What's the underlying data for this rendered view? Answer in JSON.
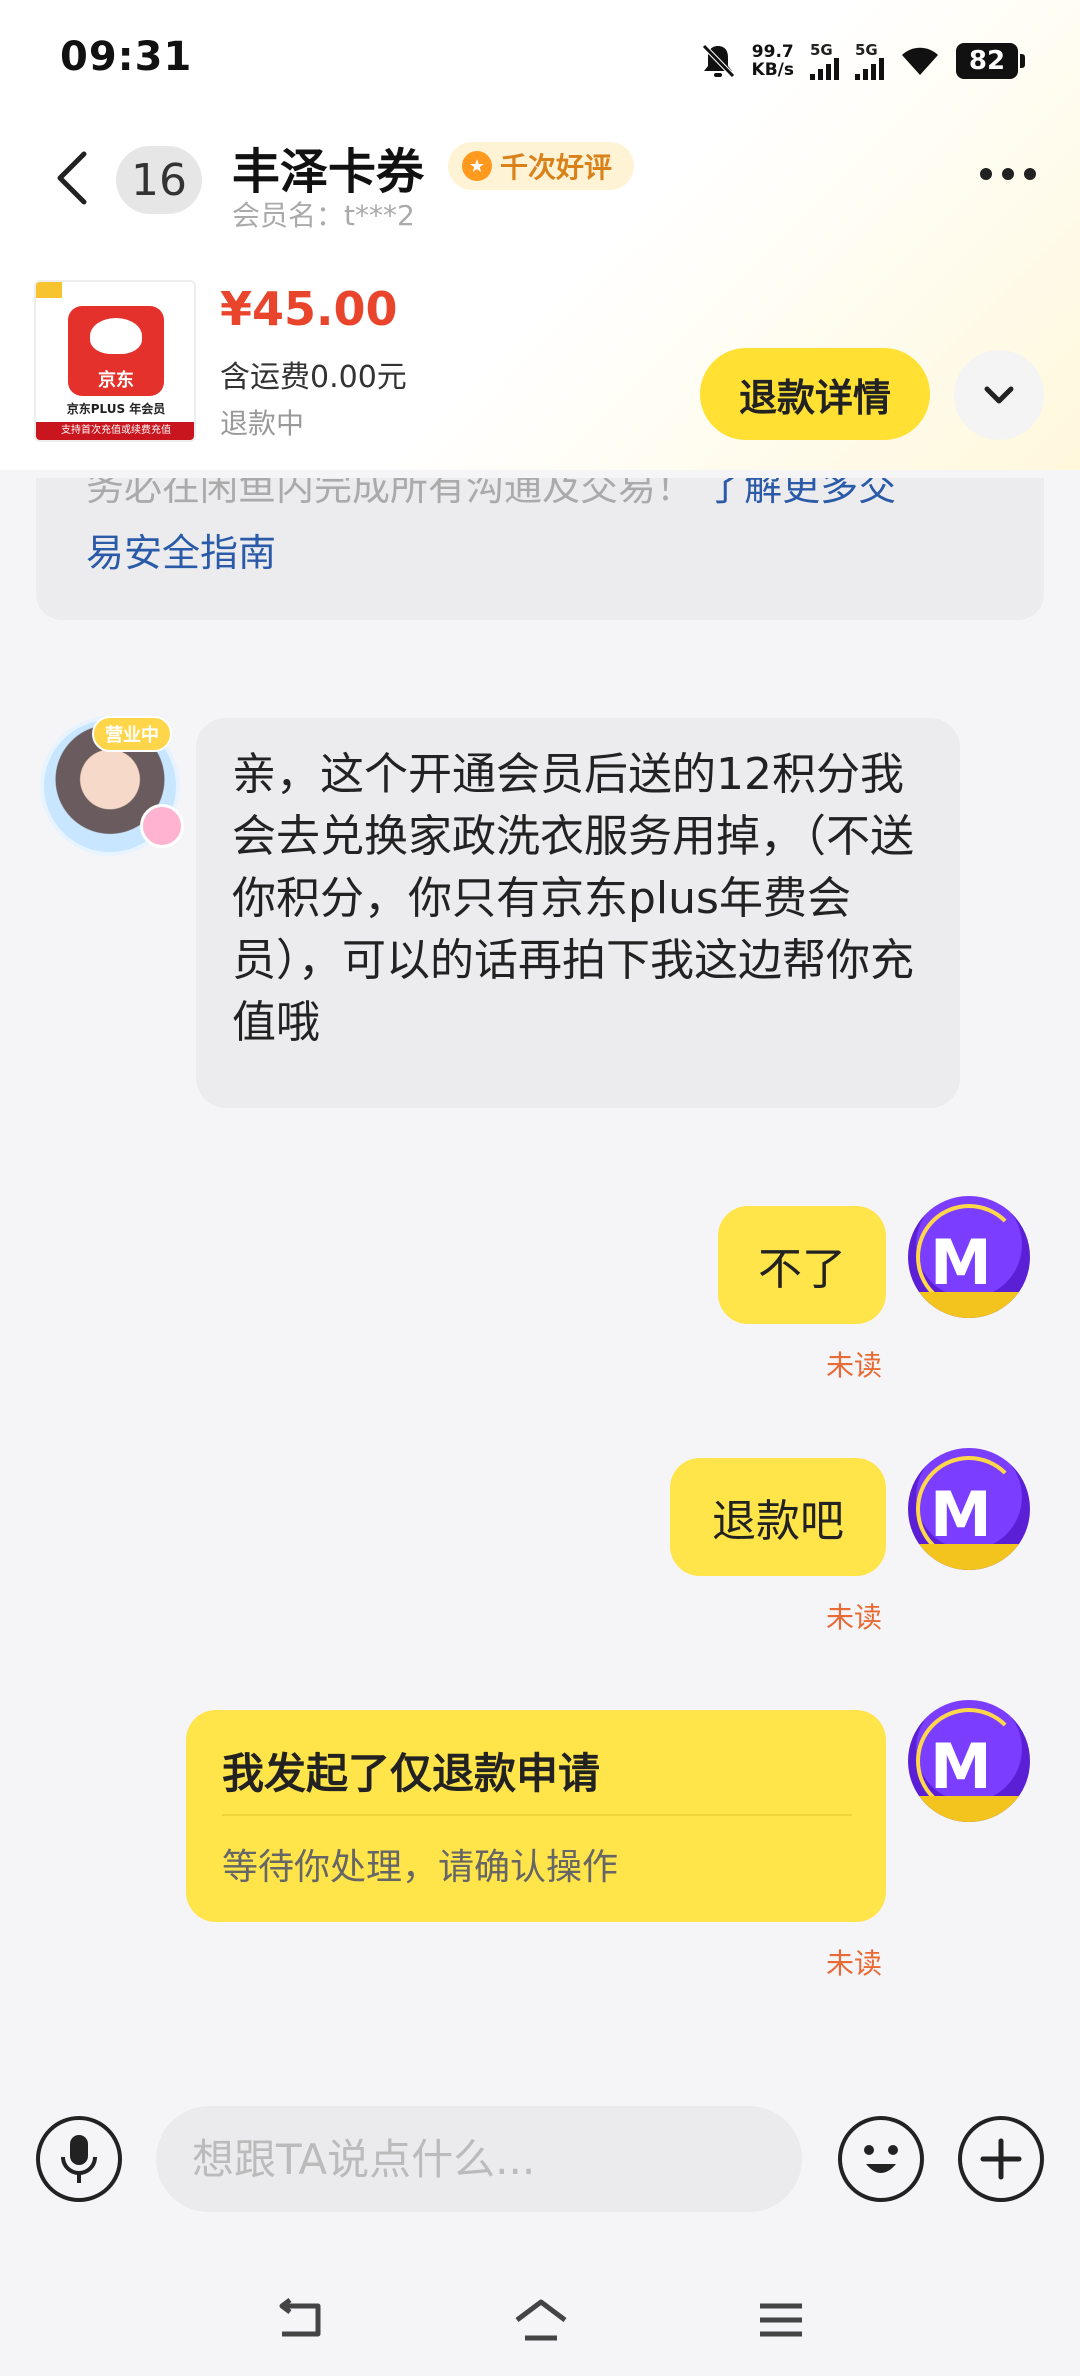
{
  "status_bar": {
    "time": "09:31",
    "net_speed_value": "99.7",
    "net_speed_unit": "KB/s",
    "sim1_label": "5G",
    "sim2_label": "5G",
    "battery": "82",
    "icons": [
      "bell-muted-icon",
      "signal-icon",
      "signal-icon",
      "wifi-icon",
      "battery-icon"
    ]
  },
  "header": {
    "unread_count": "16",
    "shop_name": "丰泽卡券",
    "badge_text": "千次好评",
    "member_label": "会员名：t***2"
  },
  "product": {
    "image_brand": "京东",
    "image_caption": "京东PLUS 年会员",
    "image_strip": "支持首次充值或续费充值",
    "price": "¥45.00",
    "shipping": "含运费0.00元",
    "status": "退款中",
    "refund_button": "退款详情"
  },
  "notice": {
    "line1_text": "务必在闲鱼内完成所有沟通及交易！",
    "line1_link": "了解更多交",
    "line2_link": "易安全指南"
  },
  "messages": [
    {
      "side": "left",
      "avatar_tag": "营业中",
      "text": "亲，这个开通会员后送的12积分我会去兑换家政洗衣服务用掉，（不送你积分，你只有京东plus年费会员），可以的话再拍下我这边帮你充值哦"
    },
    {
      "side": "right",
      "text": "不了",
      "status": "未读"
    },
    {
      "side": "right",
      "text": "退款吧",
      "status": "未读"
    },
    {
      "side": "right",
      "card_title": "我发起了仅退款申请",
      "card_subtitle": "等待你处理，请确认操作",
      "status": "未读"
    }
  ],
  "input": {
    "placeholder": "想跟TA说点什么..."
  },
  "colors": {
    "accent_yellow": "#ffe44a",
    "price_red": "#e8452c",
    "link_blue": "#2a5aa8",
    "unread_orange": "#e86a35"
  }
}
